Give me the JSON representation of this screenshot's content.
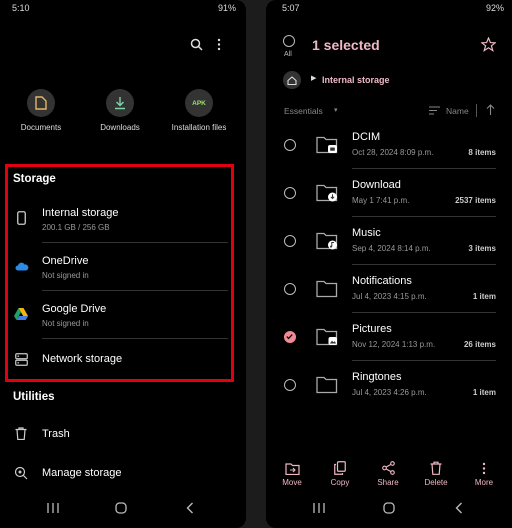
{
  "left": {
    "status": {
      "time": "5:10",
      "battery": "91%"
    },
    "quick_access": [
      {
        "label": "Documents",
        "icon": "document-icon"
      },
      {
        "label": "Downloads",
        "icon": "download-icon"
      },
      {
        "label": "Installation files",
        "icon": "apk-icon",
        "badge": "APK"
      }
    ],
    "storage": {
      "heading": "Storage",
      "items": [
        {
          "title": "Internal storage",
          "sub": "200.1 GB / 256 GB",
          "icon": "phone-icon"
        },
        {
          "title": "OneDrive",
          "sub": "Not signed in",
          "icon": "onedrive-icon"
        },
        {
          "title": "Google Drive",
          "sub": "Not signed in",
          "icon": "google-drive-icon"
        },
        {
          "title": "Network storage",
          "sub": "",
          "icon": "network-storage-icon"
        }
      ]
    },
    "utilities": {
      "heading": "Utilities",
      "items": [
        {
          "title": "Trash",
          "icon": "trash-icon"
        },
        {
          "title": "Manage storage",
          "icon": "manage-storage-icon"
        }
      ]
    }
  },
  "right": {
    "status": {
      "time": "5:07",
      "battery": "92%"
    },
    "all_label": "All",
    "selected_text": "1 selected",
    "breadcrumb": "Internal storage",
    "sort": {
      "filter": "Essentials",
      "by": "Name"
    },
    "folders": [
      {
        "name": "DCIM",
        "date": "Oct 28, 2024 8:09 p.m.",
        "count": "8 items",
        "checked": false,
        "badge": "camera"
      },
      {
        "name": "Download",
        "date": "May 1 7:41 p.m.",
        "count": "2537 items",
        "checked": false,
        "badge": "download"
      },
      {
        "name": "Music",
        "date": "Sep 4, 2024 8:14 p.m.",
        "count": "3 items",
        "checked": false,
        "badge": "music"
      },
      {
        "name": "Notifications",
        "date": "Jul 4, 2023 4:15 p.m.",
        "count": "1 item",
        "checked": false,
        "badge": ""
      },
      {
        "name": "Pictures",
        "date": "Nov 12, 2024 1:13 p.m.",
        "count": "26 items",
        "checked": true,
        "badge": "image"
      },
      {
        "name": "Ringtones",
        "date": "Jul 4, 2023 4:26 p.m.",
        "count": "1 item",
        "checked": false,
        "badge": ""
      }
    ],
    "toolbar": [
      {
        "label": "Move",
        "icon": "move-icon"
      },
      {
        "label": "Copy",
        "icon": "copy-icon"
      },
      {
        "label": "Share",
        "icon": "share-icon"
      },
      {
        "label": "Delete",
        "icon": "delete-icon"
      },
      {
        "label": "More",
        "icon": "more-icon"
      }
    ]
  },
  "colors": {
    "accent": "#f0b8c5",
    "check": "#f08a94",
    "highlight": "#e0000f"
  }
}
